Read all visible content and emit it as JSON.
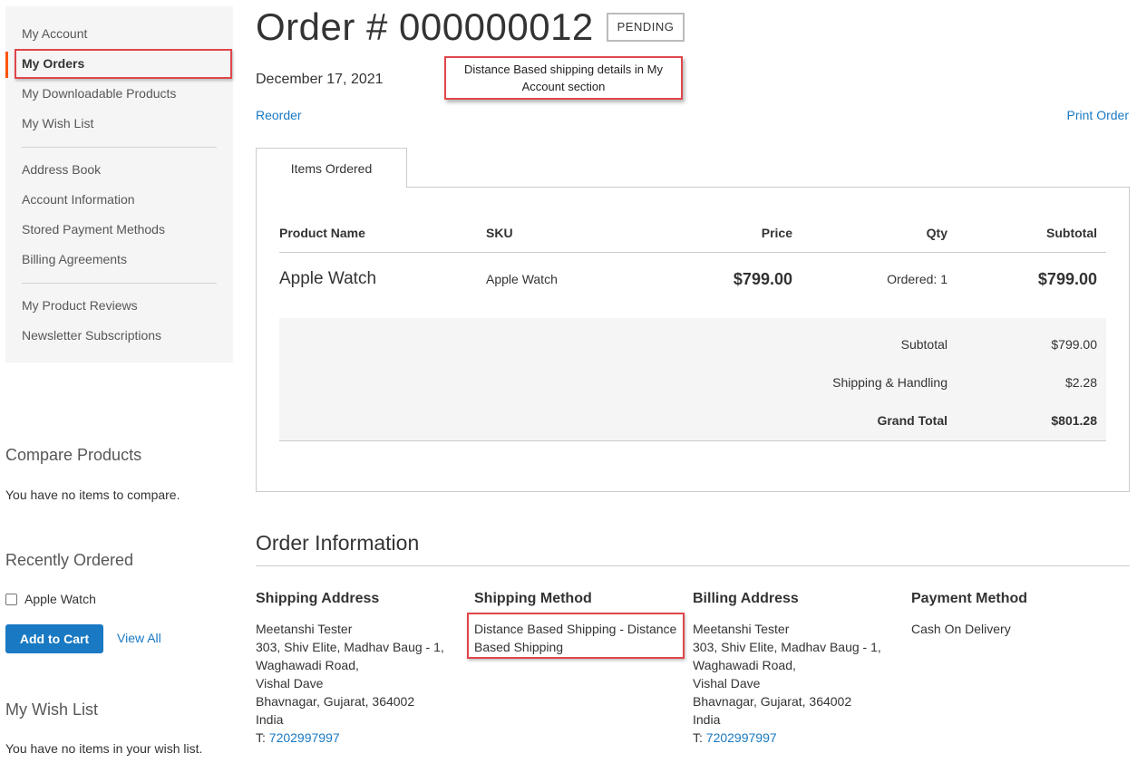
{
  "sidebar": {
    "nav_group1": [
      {
        "label": "My Account"
      },
      {
        "label": "My Orders"
      },
      {
        "label": "My Downloadable Products"
      },
      {
        "label": "My Wish List"
      }
    ],
    "nav_group2": [
      {
        "label": "Address Book"
      },
      {
        "label": "Account Information"
      },
      {
        "label": "Stored Payment Methods"
      },
      {
        "label": "Billing Agreements"
      }
    ],
    "nav_group3": [
      {
        "label": "My Product Reviews"
      },
      {
        "label": "Newsletter Subscriptions"
      }
    ],
    "compare": {
      "title": "Compare Products",
      "empty": "You have no items to compare."
    },
    "recent": {
      "title": "Recently Ordered",
      "item": "Apple Watch",
      "add_to_cart": "Add to Cart",
      "view_all": "View All"
    },
    "wishlist": {
      "title": "My Wish List",
      "empty": "You have no items in your wish list."
    }
  },
  "order": {
    "title": "Order # 000000012",
    "status": "PENDING",
    "date": "December 17, 2021",
    "reorder": "Reorder",
    "print": "Print Order",
    "callout": "Distance Based shipping details in My Account section",
    "tab": "Items Ordered",
    "columns": {
      "name": "Product Name",
      "sku": "SKU",
      "price": "Price",
      "qty": "Qty",
      "subtotal": "Subtotal"
    },
    "item": {
      "name": "Apple Watch",
      "sku": "Apple Watch",
      "price": "$799.00",
      "qty_label": "Ordered:",
      "qty": "1",
      "subtotal": "$799.00"
    },
    "totals": [
      {
        "label": "Subtotal",
        "value": "$799.00"
      },
      {
        "label": "Shipping & Handling",
        "value": "$2.28"
      },
      {
        "label": "Grand Total",
        "value": "$801.28"
      }
    ]
  },
  "info": {
    "title": "Order Information",
    "shipping_address": {
      "title": "Shipping Address",
      "lines": [
        "Meetanshi Tester",
        "303, Shiv Elite, Madhav Baug - 1,",
        "Waghawadi Road,",
        "Vishal Dave",
        "Bhavnagar, Gujarat, 364002",
        "India"
      ],
      "phone_label": "T:",
      "phone": "7202997997"
    },
    "shipping_method": {
      "title": "Shipping Method",
      "lines": [
        "Distance Based Shipping - Distance",
        "Based Shipping"
      ]
    },
    "billing_address": {
      "title": "Billing Address",
      "lines": [
        "Meetanshi Tester",
        "303, Shiv Elite, Madhav Baug - 1,",
        "Waghawadi Road,",
        "Vishal Dave",
        "Bhavnagar, Gujarat, 364002",
        "India"
      ],
      "phone_label": "T:",
      "phone": "7202997997"
    },
    "payment_method": {
      "title": "Payment Method",
      "value": "Cash On Delivery"
    }
  },
  "colors": {
    "accent": "#1979c3",
    "active_marker": "#ff5501",
    "highlight": "#e0464b"
  }
}
